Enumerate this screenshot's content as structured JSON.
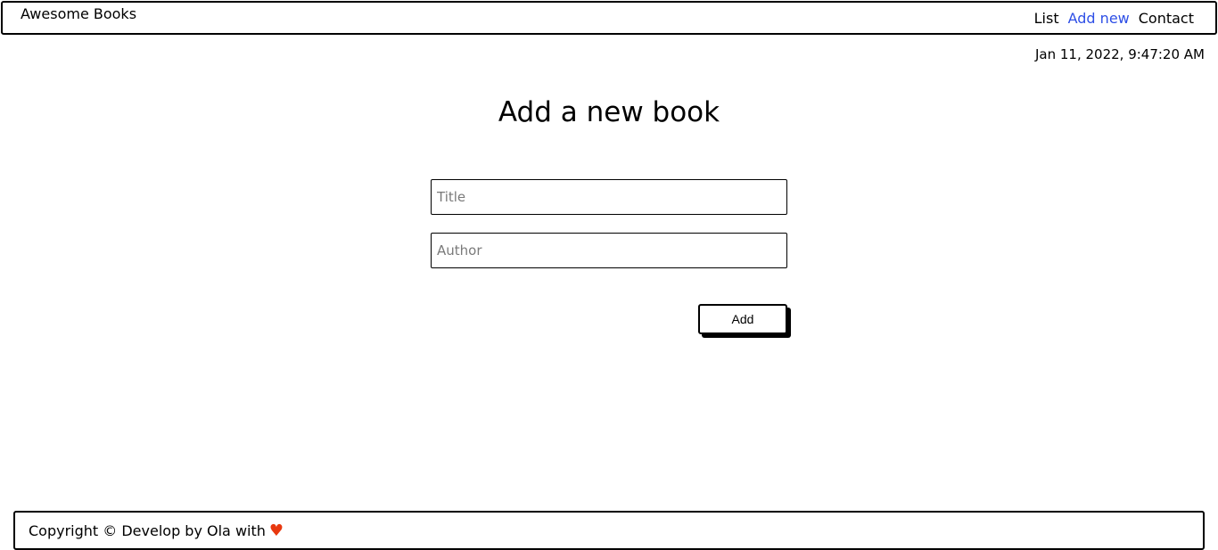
{
  "header": {
    "brand": "Awesome Books",
    "nav": [
      {
        "label": "List",
        "active": false
      },
      {
        "label": "Add new",
        "active": true
      },
      {
        "label": "Contact",
        "active": false
      }
    ]
  },
  "datetime": "Jan 11, 2022, 9:47:20 AM",
  "main": {
    "title": "Add a new book",
    "form": {
      "title_placeholder": "Title",
      "title_value": "",
      "author_placeholder": "Author",
      "author_value": "",
      "add_label": "Add"
    }
  },
  "footer": {
    "text": "Copyright © Develop by Ola with",
    "heart_icon": "♥"
  },
  "colors": {
    "active_link": "#2e4fe6",
    "heart": "#e8380f"
  }
}
